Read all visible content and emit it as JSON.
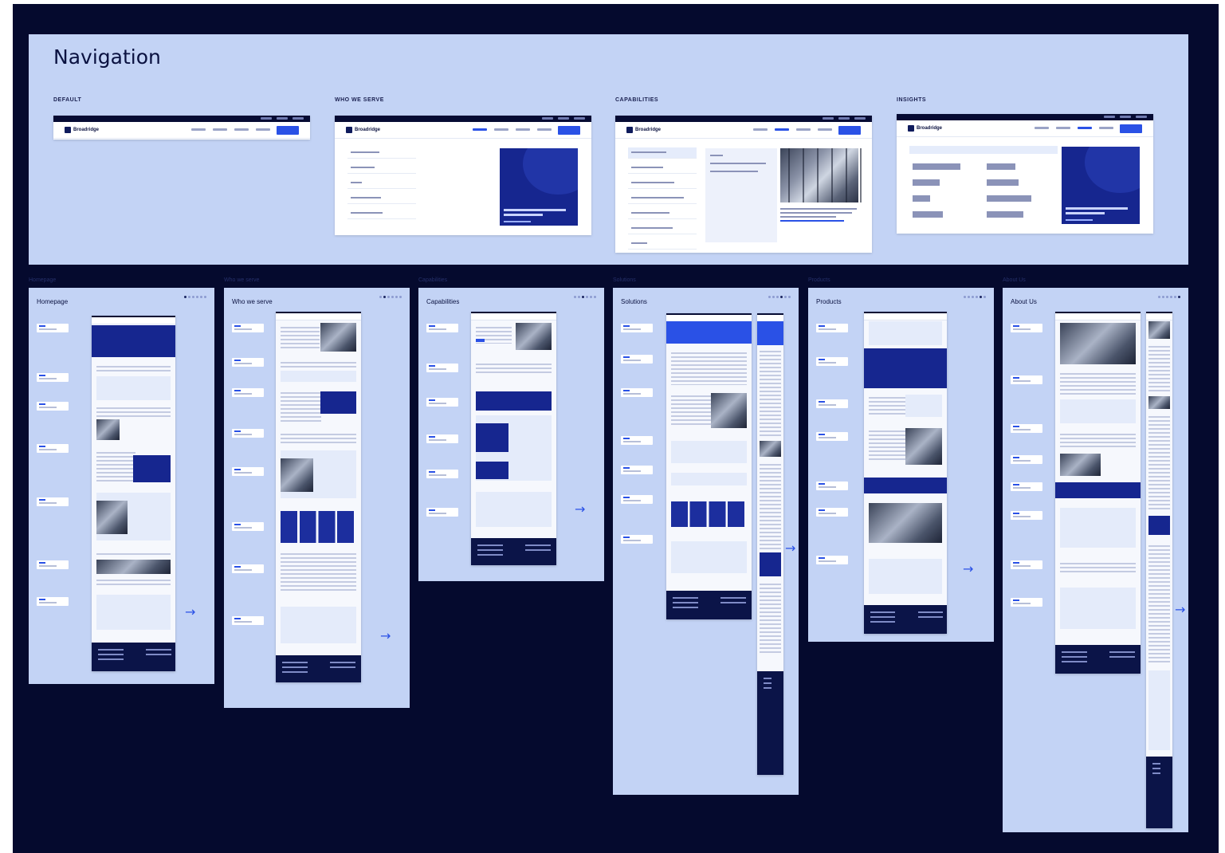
{
  "navigation": {
    "title": "Navigation",
    "variants": [
      {
        "label": "DEFAULT"
      },
      {
        "label": "WHO WE SERVE"
      },
      {
        "label": "CAPABILITIES"
      },
      {
        "label": "INSIGHTS"
      }
    ],
    "logo_text": "Broadridge"
  },
  "sections": [
    {
      "label": "Homepage",
      "title": "Homepage"
    },
    {
      "label": "Who we serve",
      "title": "Who we serve"
    },
    {
      "label": "Capabilities",
      "title": "Capabilities"
    },
    {
      "label": "Solutions",
      "title": "Solutions"
    },
    {
      "label": "Products",
      "title": "Products"
    },
    {
      "label": "About Us",
      "title": "About Us"
    }
  ],
  "icons": {
    "next_arrow": "arrow-right-icon",
    "glyph": "→"
  },
  "colors": {
    "canvas": "#050a2e",
    "panel": "#c3d3f5",
    "accent": "#2a51e6",
    "navy": "#0b1448"
  }
}
